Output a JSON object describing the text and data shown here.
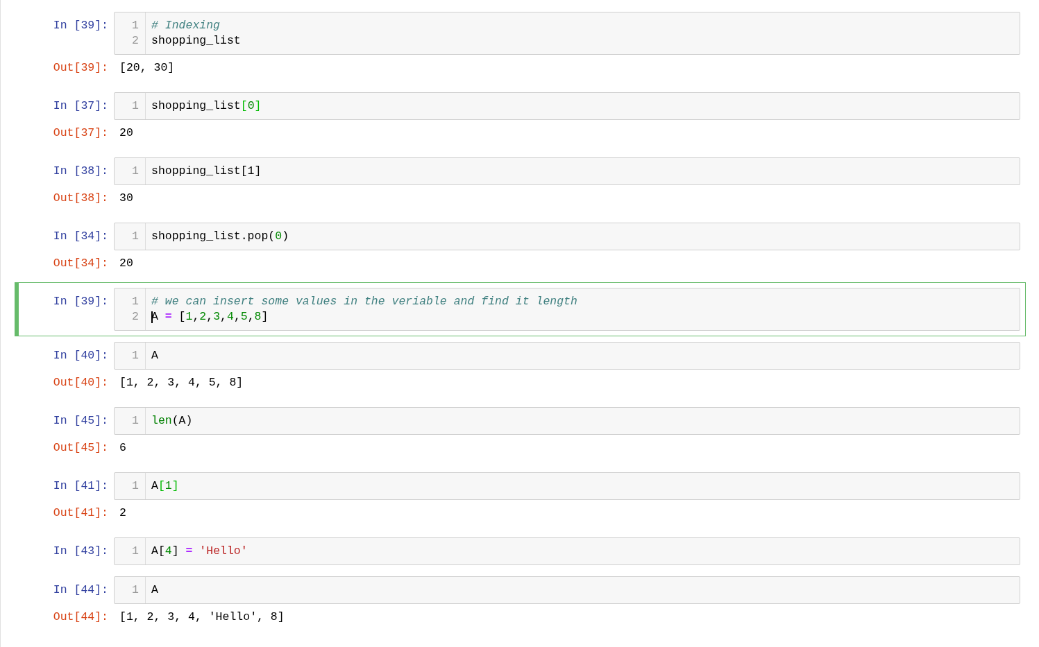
{
  "cells": [
    {
      "prompt": "In [39]:",
      "selected": false,
      "lines": [
        {
          "number": "1",
          "tokens": [
            {
              "kind": "comment",
              "text": "# Indexing"
            }
          ]
        },
        {
          "number": "2",
          "tokens": [
            {
              "kind": "plain",
              "text": "shopping_list"
            }
          ]
        }
      ],
      "output": {
        "prompt": "Out[39]:",
        "text": "[20, 30]"
      }
    },
    {
      "prompt": "In [37]:",
      "selected": false,
      "lines": [
        {
          "number": "1",
          "tokens": [
            {
              "kind": "plain",
              "text": "shopping_list"
            },
            {
              "kind": "matched-bracket",
              "text": "["
            },
            {
              "kind": "number",
              "text": "0"
            },
            {
              "kind": "matched-bracket",
              "text": "]"
            }
          ]
        }
      ],
      "output": {
        "prompt": "Out[37]:",
        "text": "20"
      }
    },
    {
      "prompt": "In [38]:",
      "selected": false,
      "lines": [
        {
          "number": "1",
          "tokens": [
            {
              "kind": "plain",
              "text": "shopping_list[1]"
            }
          ]
        }
      ],
      "output": {
        "prompt": "Out[38]:",
        "text": "30"
      }
    },
    {
      "prompt": "In [34]:",
      "selected": false,
      "lines": [
        {
          "number": "1",
          "tokens": [
            {
              "kind": "plain",
              "text": "shopping_list.pop("
            },
            {
              "kind": "number",
              "text": "0"
            },
            {
              "kind": "plain",
              "text": ")"
            }
          ]
        }
      ],
      "output": {
        "prompt": "Out[34]:",
        "text": "20"
      }
    },
    {
      "prompt": "In [39]:",
      "selected": true,
      "lines": [
        {
          "number": "1",
          "tokens": [
            {
              "kind": "comment",
              "text": "# we can insert some values in the veriable and find it length"
            }
          ]
        },
        {
          "number": "2",
          "cursor": true,
          "tokens": [
            {
              "kind": "plain",
              "text": "A "
            },
            {
              "kind": "operator",
              "text": "="
            },
            {
              "kind": "plain",
              "text": " ["
            },
            {
              "kind": "number",
              "text": "1"
            },
            {
              "kind": "plain",
              "text": ","
            },
            {
              "kind": "number",
              "text": "2"
            },
            {
              "kind": "plain",
              "text": ","
            },
            {
              "kind": "number",
              "text": "3"
            },
            {
              "kind": "plain",
              "text": ","
            },
            {
              "kind": "number",
              "text": "4"
            },
            {
              "kind": "plain",
              "text": ","
            },
            {
              "kind": "number",
              "text": "5"
            },
            {
              "kind": "plain",
              "text": ","
            },
            {
              "kind": "number",
              "text": "8"
            },
            {
              "kind": "plain",
              "text": "]"
            }
          ]
        }
      ]
    },
    {
      "prompt": "In [40]:",
      "selected": false,
      "lines": [
        {
          "number": "1",
          "tokens": [
            {
              "kind": "plain",
              "text": "A"
            }
          ]
        }
      ],
      "output": {
        "prompt": "Out[40]:",
        "text": "[1, 2, 3, 4, 5, 8]"
      }
    },
    {
      "prompt": "In [45]:",
      "selected": false,
      "lines": [
        {
          "number": "1",
          "tokens": [
            {
              "kind": "builtin",
              "text": "len"
            },
            {
              "kind": "plain",
              "text": "(A)"
            }
          ]
        }
      ],
      "output": {
        "prompt": "Out[45]:",
        "text": "6"
      }
    },
    {
      "prompt": "In [41]:",
      "selected": false,
      "lines": [
        {
          "number": "1",
          "tokens": [
            {
              "kind": "plain",
              "text": "A"
            },
            {
              "kind": "matched-bracket",
              "text": "["
            },
            {
              "kind": "number",
              "text": "1"
            },
            {
              "kind": "matched-bracket",
              "text": "]"
            }
          ]
        }
      ],
      "output": {
        "prompt": "Out[41]:",
        "text": "2"
      }
    },
    {
      "prompt": "In [43]:",
      "selected": false,
      "lines": [
        {
          "number": "1",
          "tokens": [
            {
              "kind": "plain",
              "text": "A["
            },
            {
              "kind": "number",
              "text": "4"
            },
            {
              "kind": "plain",
              "text": "] "
            },
            {
              "kind": "operator",
              "text": "="
            },
            {
              "kind": "string",
              "text": " 'Hello'"
            }
          ]
        }
      ]
    },
    {
      "prompt": "In [44]:",
      "selected": false,
      "lines": [
        {
          "number": "1",
          "tokens": [
            {
              "kind": "plain",
              "text": "A"
            }
          ]
        }
      ],
      "output": {
        "prompt": "Out[44]:",
        "text": "[1, 2, 3, 4, 'Hello', 8]"
      }
    }
  ]
}
